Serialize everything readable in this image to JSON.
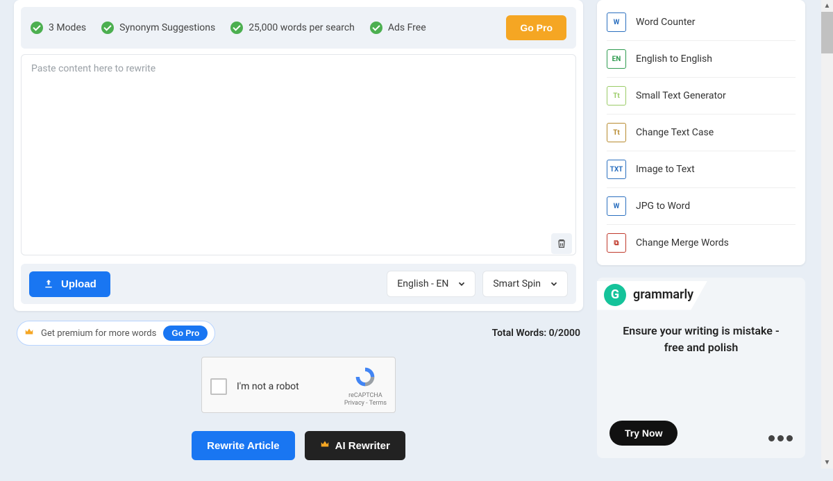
{
  "features": {
    "modes": "3 Modes",
    "synonym": "Synonym Suggestions",
    "words": "25,000 words per search",
    "adsfree": "Ads Free",
    "gopro": "Go Pro"
  },
  "textarea": {
    "placeholder": "Paste content here to rewrite"
  },
  "controls": {
    "upload": "Upload",
    "lang": "English - EN",
    "mode": "Smart Spin"
  },
  "premium": {
    "text": "Get premium for more words",
    "gopro": "Go Pro"
  },
  "stats": {
    "label": "Total Words: 0/2000"
  },
  "captcha": {
    "label": "I'm not a robot",
    "brand": "reCAPTCHA",
    "terms": "Privacy - Terms"
  },
  "actions": {
    "rewrite": "Rewrite Article",
    "ai": "AI Rewriter"
  },
  "sidebar_tools": [
    {
      "icon": "W",
      "label": "Word Counter"
    },
    {
      "icon": "EN",
      "label": "English to English"
    },
    {
      "icon": "Tt",
      "label": "Small Text Generator"
    },
    {
      "icon": "Tt",
      "label": "Change Text Case"
    },
    {
      "icon": "TXT",
      "label": "Image to Text"
    },
    {
      "icon": "W",
      "label": "JPG to Word"
    },
    {
      "icon": "⧉",
      "label": "Change Merge Words"
    }
  ],
  "ad": {
    "brand": "grammarly",
    "copy": "Ensure your writing is mistake - free and polish",
    "cta": "Try Now"
  }
}
